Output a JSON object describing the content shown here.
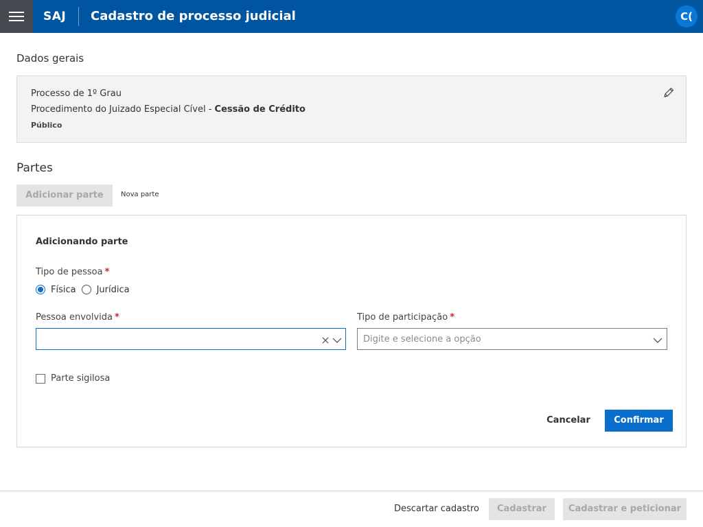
{
  "topbar": {
    "brand": "SAJ",
    "title": "Cadastro de processo judicial",
    "avatar_initials": "C(",
    "menu_icon": "hamburger-menu-icon",
    "background": "#0055a0"
  },
  "dados_gerais": {
    "title": "Dados gerais",
    "line1": "Processo de 1º Grau",
    "line2_prefix": "Procedimento do Juizado Especial Cível - ",
    "line2_bold": "Cessão de Crédito",
    "line3": "Público",
    "edit_icon": "pencil-icon"
  },
  "partes": {
    "title": "Partes",
    "add_button_label": "Adicionar parte",
    "nova_parte_label": "Nova parte"
  },
  "form": {
    "title": "Adicionando parte",
    "tipo_pessoa": {
      "label": "Tipo de pessoa",
      "required_mark": "*",
      "options": [
        {
          "label": "Física",
          "checked": true
        },
        {
          "label": "Jurídica",
          "checked": false
        }
      ]
    },
    "pessoa_envolvida": {
      "label": "Pessoa envolvida",
      "required_mark": "*",
      "value": "",
      "placeholder": ""
    },
    "tipo_participacao": {
      "label": "Tipo de participação",
      "required_mark": "*",
      "value": "",
      "placeholder": "Digite e selecione a opção"
    },
    "parte_sigilosa": {
      "label": "Parte sigilosa",
      "checked": false
    },
    "cancel_label": "Cancelar",
    "confirm_label": "Confirmar",
    "accent": "#0a6ecc"
  },
  "footer": {
    "discard_label": "Descartar cadastro",
    "cadastrar_label": "Cadastrar",
    "cadastrar_peticionar_label": "Cadastrar e peticionar"
  }
}
